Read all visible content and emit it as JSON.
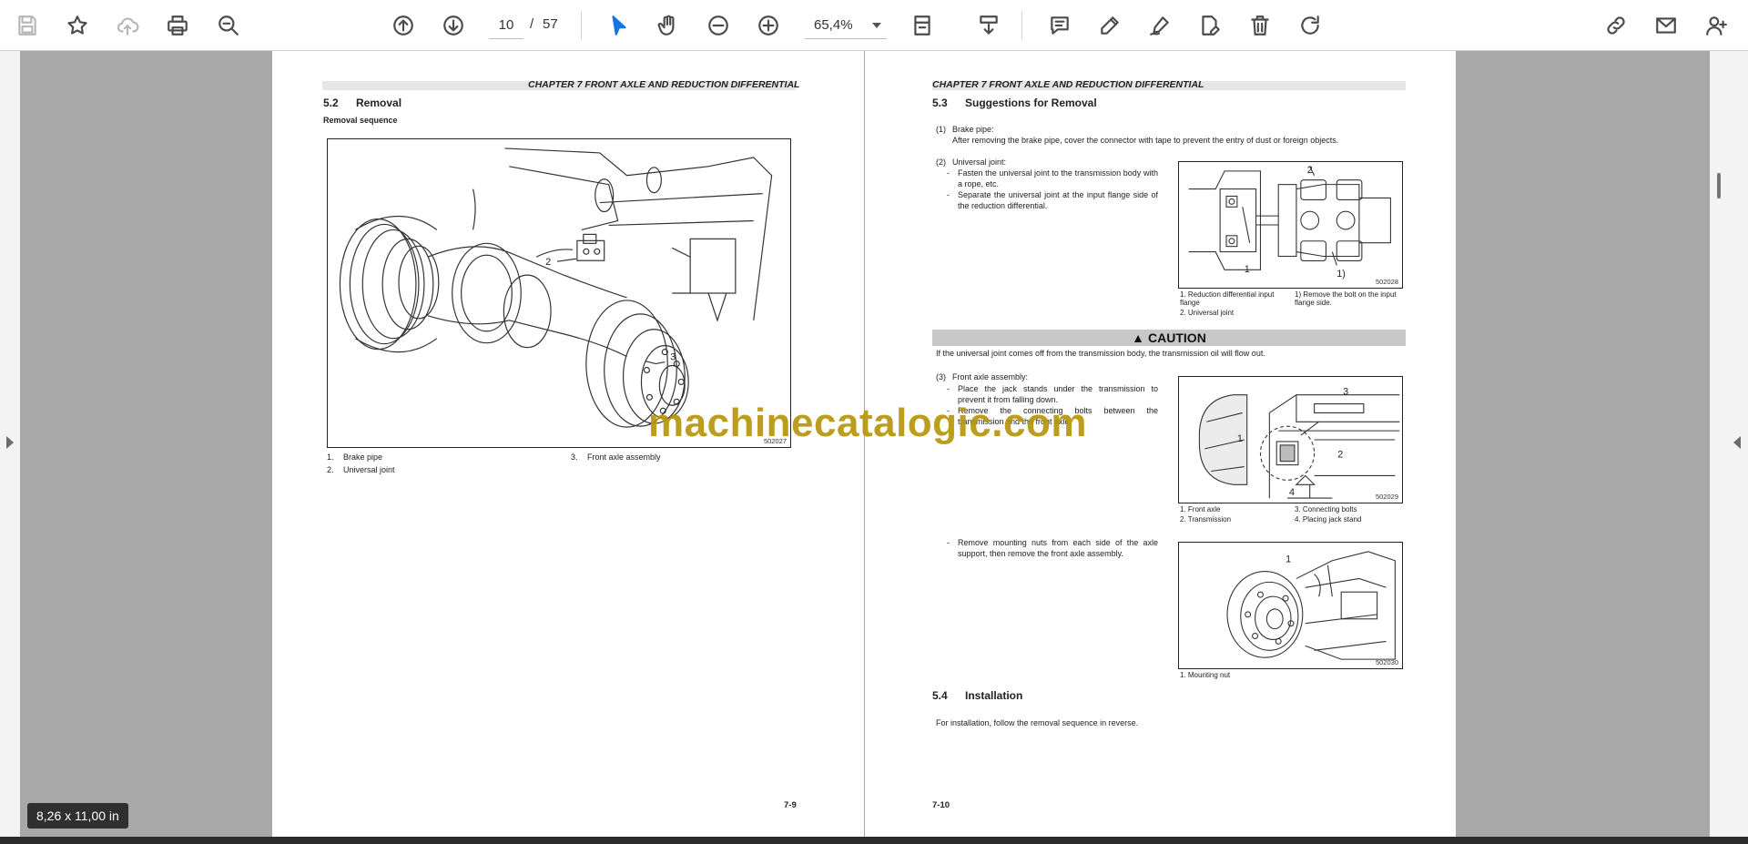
{
  "toolbar": {
    "page_current": "10",
    "page_separator": "/",
    "page_total": "57",
    "zoom": "65,4%",
    "icons": [
      "save-icon",
      "bookmark-star-icon",
      "cloud-upload-icon",
      "print-icon",
      "zoom-search-icon",
      "page-up-icon",
      "page-down-icon",
      "select-pointer-icon",
      "hand-tool-icon",
      "zoom-out-icon",
      "zoom-in-icon",
      "page-fit-icon",
      "scroll-mode-icon",
      "comment-icon",
      "highlight-pen-icon",
      "sign-icon",
      "edit-pdf-icon",
      "delete-icon",
      "rotate-icon",
      "share-link-icon",
      "email-icon",
      "add-user-icon"
    ]
  },
  "left_page": {
    "header": "CHAPTER 7 FRONT AXLE AND REDUCTION DIFFERENTIAL",
    "section_number": "5.2",
    "section_title": "Removal",
    "subheading": "Removal sequence",
    "figure_id": "502027",
    "callouts": [
      "2",
      "3"
    ],
    "legend": [
      "1.",
      "Brake pipe",
      "2.",
      "Universal joint",
      "3.",
      "Front axle assembly"
    ],
    "page_number": "7-9"
  },
  "right_page": {
    "header": "CHAPTER 7 FRONT AXLE AND REDUCTION DIFFERENTIAL",
    "section_number": "5.3",
    "section_title": "Suggestions for Removal",
    "item1_label": "(1)",
    "item1_title": "Brake pipe:",
    "item1_text": "After removing the brake pipe, cover the connector with tape to prevent the entry of dust or foreign objects.",
    "item2_label": "(2)",
    "item2_title": "Universal joint:",
    "item2_bullets": [
      "Fasten the universal joint to the transmission body with a rope, etc.",
      "Separate the universal joint at the input flange side of the reduction differential."
    ],
    "fig2_id": "502028",
    "fig2_callouts": [
      "2",
      "1",
      "1)"
    ],
    "fig2_legend": [
      "1. Reduction differential input flange",
      "2. Universal joint",
      "1) Remove the bolt on the input flange side."
    ],
    "caution_title": "CAUTION",
    "caution_text": "If the universal joint comes off from the transmission body, the transmission oil will flow out.",
    "item3_label": "(3)",
    "item3_title": "Front axle assembly:",
    "item3_bullets": [
      "Place the jack stands under the transmission to prevent it from falling down.",
      "Remove the connecting bolts between the transmission and the front axle."
    ],
    "fig3_id": "502029",
    "fig3_callouts": [
      "1",
      "2",
      "3",
      "4"
    ],
    "fig3_legend": [
      "1. Front axle",
      "2. Transmission",
      "3. Connecting bolts",
      "4. Placing jack stand"
    ],
    "item4_bullet": "Remove mounting nuts from each side of the axle support, then remove the front axle assembly.",
    "fig4_id": "502030",
    "fig4_callouts": [
      "1"
    ],
    "fig4_legend": [
      "1. Mounting nut"
    ],
    "section2_number": "5.4",
    "section2_title": "Installation",
    "installation_text": "For installation, follow the removal sequence in reverse.",
    "page_number": "7-10"
  },
  "watermark": "machinecatalogic.com",
  "page_size_tooltip": "8,26 x 11,00 in"
}
